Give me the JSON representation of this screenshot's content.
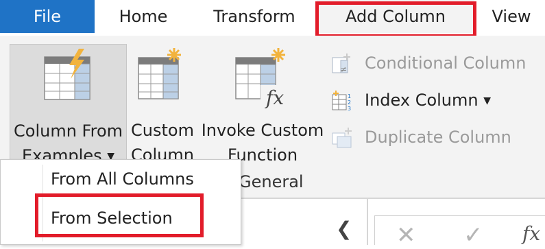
{
  "tabs": [
    {
      "label": "File"
    },
    {
      "label": "Home"
    },
    {
      "label": "Transform"
    },
    {
      "label": "Add Column",
      "active": true
    },
    {
      "label": "View"
    }
  ],
  "ribbon": {
    "column_from_examples": {
      "line1": "Column From",
      "line2": "Examples",
      "caret": "▼"
    },
    "custom_column": {
      "line1": "Custom",
      "line2": "Column"
    },
    "invoke_custom_function": {
      "line1": "Invoke Custom",
      "line2": "Function"
    },
    "conditional_column": {
      "label": "Conditional Column",
      "enabled": false
    },
    "index_column": {
      "label": "Index Column",
      "caret": "▼"
    },
    "duplicate_column": {
      "label": "Duplicate Column",
      "enabled": false
    },
    "group_label": "General"
  },
  "dropdown": {
    "items": [
      {
        "label": "From All Columns"
      },
      {
        "label": "From Selection",
        "highlighted": true
      }
    ]
  },
  "formula_bar": {
    "collapse_glyph": "❮",
    "cancel_glyph": "✕",
    "commit_glyph": "✓",
    "fx_label": "fx"
  },
  "colors": {
    "file_tab": "#1f73c6",
    "highlight": "#e21c2a",
    "ribbon_bg": "#f3f3f3",
    "icon_accent": "#f2b33d",
    "icon_blue": "#bcd0e6"
  }
}
